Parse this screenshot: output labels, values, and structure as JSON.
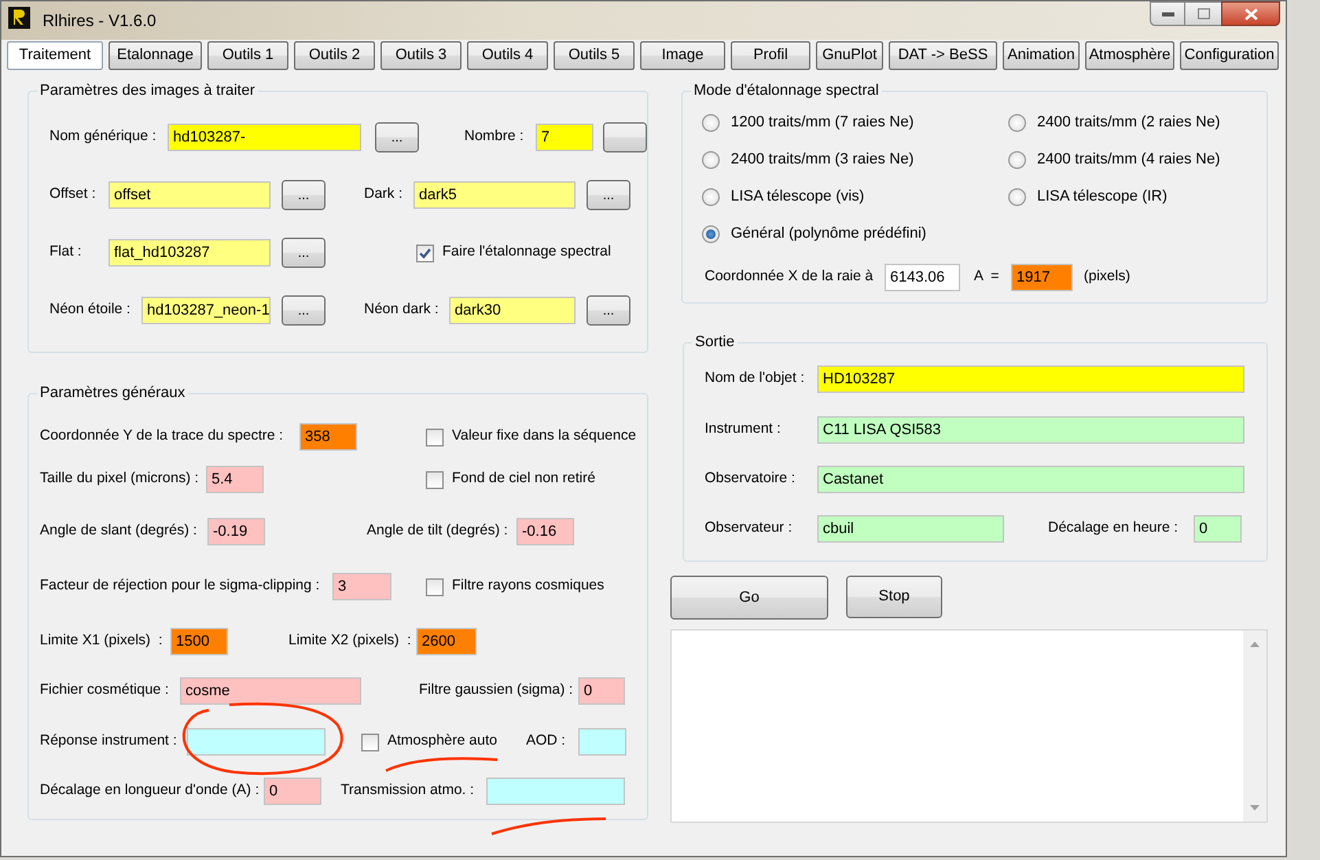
{
  "window": {
    "title": "Rlhires - V1.6.0"
  },
  "tabs": [
    {
      "label": "Traitement",
      "selected": true
    },
    {
      "label": "Etalonnage",
      "selected": false
    },
    {
      "label": "Outils 1",
      "selected": false
    },
    {
      "label": "Outils 2",
      "selected": false
    },
    {
      "label": "Outils 3",
      "selected": false
    },
    {
      "label": "Outils 4",
      "selected": false
    },
    {
      "label": "Outils 5",
      "selected": false
    },
    {
      "label": "Image",
      "selected": false
    },
    {
      "label": "Profil",
      "selected": false
    },
    {
      "label": "GnuPlot",
      "selected": false
    },
    {
      "label": "DAT -> BeSS",
      "selected": false
    },
    {
      "label": "Animation",
      "selected": false
    },
    {
      "label": "Atmosphère",
      "selected": false
    },
    {
      "label": "Configuration",
      "selected": false
    }
  ],
  "images_panel": {
    "title": "Paramètres des images à traiter",
    "fields": [
      {
        "label": "Nom générique :",
        "value": "hd103287-",
        "color": "#ffff00",
        "button": "..."
      },
      {
        "label": "Nombre :",
        "value": "7",
        "color": "#ffff00"
      },
      {
        "label": "Offset :",
        "value": "offset",
        "color": "#ffff80",
        "button": "..."
      },
      {
        "label": "Dark :",
        "value": "dark5",
        "color": "#ffff80",
        "button": "..."
      },
      {
        "label": "Flat :",
        "value": "flat_hd103287",
        "color": "#ffff80",
        "button": "..."
      },
      {
        "label": "Néon étoile :",
        "value": "hd103287_neon-1",
        "color": "#ffff80",
        "button": "..."
      },
      {
        "label": "Néon dark :",
        "value": "dark30",
        "color": "#ffff80",
        "button": "..."
      }
    ],
    "checkbox": {
      "label": "Faire l'étalonnage spectral",
      "checked": true
    }
  },
  "general_panel": {
    "title": "Paramètres généraux",
    "fields": [
      {
        "label": "Coordonnée Y de la trace du spectre :",
        "value": "358",
        "color": "#ff8000"
      },
      {
        "label": "Taille du pixel (microns) :",
        "value": "5.4",
        "color": "#ffc0c0"
      },
      {
        "label": "Angle de slant (degrés) :",
        "value": "-0.19",
        "color": "#ffc0c0"
      },
      {
        "label": "Angle de tilt (degrés) :",
        "value": "-0.16",
        "color": "#ffc0c0"
      },
      {
        "label": "Facteur de réjection pour le sigma-clipping :",
        "value": "3",
        "color": "#ffc0c0"
      },
      {
        "label": "Limite X1 (pixels)  :",
        "value": "1500",
        "color": "#ff8000"
      },
      {
        "label": "Limite X2 (pixels)  :",
        "value": "2600",
        "color": "#ff8000"
      },
      {
        "label": "Fichier cosmétique :",
        "value": "cosme",
        "color": "#ffc0c0"
      },
      {
        "label": "Filtre gaussien (sigma) :",
        "value": "0",
        "color": "#ffc0c0"
      },
      {
        "label": "Réponse instrument :",
        "color": "#c0ffff"
      },
      {
        "label": "AOD :",
        "color": "#c0ffff"
      },
      {
        "label": "Décalage en longueur d'onde (A) :",
        "value": "0",
        "color": "#ffc0c0"
      },
      {
        "label": "Transmission atmo. :",
        "color": "#c0ffff"
      }
    ],
    "checkboxes": [
      {
        "label": "Valeur fixe dans la séquence",
        "checked": false
      },
      {
        "label": "Fond de ciel non retiré",
        "checked": false
      },
      {
        "label": "Filtre rayons cosmiques",
        "checked": false
      },
      {
        "label": "Atmosphère auto",
        "checked": false
      }
    ]
  },
  "mode_panel": {
    "title": "Mode d'étalonnage spectral",
    "options": [
      {
        "label": "1200 traits/mm (7 raies Ne)",
        "selected": false
      },
      {
        "label": "2400 traits/mm (2 raies Ne)",
        "selected": false
      },
      {
        "label": "2400 traits/mm (3 raies Ne)",
        "selected": false
      },
      {
        "label": "2400 traits/mm (4 raies Ne)",
        "selected": false
      },
      {
        "label": "LISA télescope (vis)",
        "selected": false
      },
      {
        "label": "LISA télescope (IR)",
        "selected": false
      },
      {
        "label": "Général (polynôme prédéfini)",
        "selected": true
      }
    ],
    "coordinate": {
      "label": "Coordonnée X de la raie à",
      "fields": [
        {
          "value": "6143.06",
          "color": "#ffffff"
        },
        {
          "value": "1917",
          "color": "#ff8000"
        }
      ],
      "unit_label": "A  =",
      "suffix": "(pixels)"
    }
  },
  "output_panel": {
    "title": "Sortie",
    "fields": [
      {
        "label": "Nom de l'objet :",
        "value": "HD103287",
        "color": "#ffff00"
      },
      {
        "label": "Instrument :",
        "value": "C11 LISA QSI583",
        "color": "#c0ffc0"
      },
      {
        "label": "Observatoire :",
        "value": "Castanet",
        "color": "#c0ffc0"
      },
      {
        "label": "Observateur :",
        "value": "cbuil",
        "color": "#c0ffc0"
      },
      {
        "label": "Décalage en heure :",
        "value": "0",
        "color": "#c0ffc0"
      }
    ]
  },
  "actions": [
    "Go",
    "Stop"
  ]
}
